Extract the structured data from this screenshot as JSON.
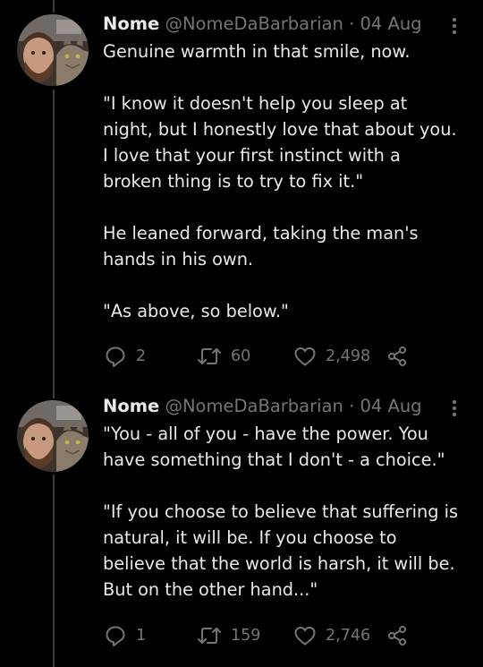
{
  "tweets": [
    {
      "name": "Nome",
      "handle": "@NomeDaBarbarian",
      "separator": "·",
      "date": "04 Aug",
      "icons": {
        "avatar": "profile-photo-man-with-cat",
        "more": "more-vertical-icon",
        "reply": "reply-icon",
        "retweet": "retweet-icon",
        "like": "heart-icon",
        "share": "share-icon"
      },
      "lines": [
        "Genuine warmth in that smile, now.",
        "",
        "\"I know it doesn't help you sleep at",
        "night, but I honestly love that about you.",
        "I love that your first instinct with a",
        "broken thing is to try to fix it.\"",
        "",
        "He leaned forward, taking the man's",
        "hands in his own.",
        "",
        "\"As above, so below.\""
      ],
      "replies": "2",
      "retweets": "60",
      "likes": "2,498"
    },
    {
      "name": "Nome",
      "handle": "@NomeDaBarbarian",
      "separator": "·",
      "date": "04 Aug",
      "icons": {
        "avatar": "profile-photo-man-with-cat",
        "more": "more-vertical-icon",
        "reply": "reply-icon",
        "retweet": "retweet-icon",
        "like": "heart-icon",
        "share": "share-icon"
      },
      "lines": [
        "\"You - all of you - have the power. You",
        "have something that I don't - a choice.\"",
        "",
        "\"If you choose to believe that suffering is",
        "natural, it will be. If you choose to",
        "believe that the world is harsh, it will be.",
        "But on the other hand...\""
      ],
      "replies": "1",
      "retweets": "159",
      "likes": "2,746"
    }
  ],
  "colors": {
    "background": "#000000",
    "text": "#e7e9ea",
    "muted": "#71767b",
    "thread_line": "#3a3d40"
  }
}
